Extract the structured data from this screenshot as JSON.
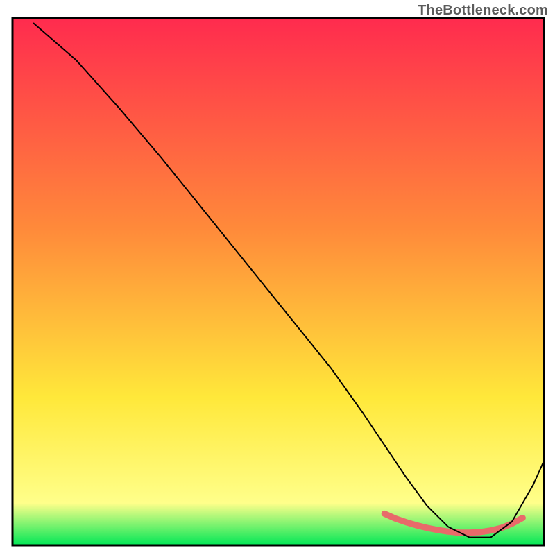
{
  "attribution": "TheBottleneck.com",
  "chart_data": {
    "type": "line",
    "title": "",
    "xlabel": "",
    "ylabel": "",
    "xlim": [
      0,
      100
    ],
    "ylim": [
      0,
      100
    ],
    "grid": false,
    "legend": false,
    "background_gradient": {
      "top": "#ff2b4e",
      "mid1": "#ff8a3a",
      "mid2": "#ffe83a",
      "low": "#ffff8a",
      "bottom": "#00e756"
    },
    "series": [
      {
        "name": "bottleneck-curve",
        "color": "#000000",
        "stroke_width": 2,
        "x": [
          4,
          12,
          20,
          28,
          36,
          44,
          52,
          60,
          66,
          70,
          74,
          78,
          82,
          86,
          90,
          94,
          98,
          100
        ],
        "y": [
          99,
          92,
          83,
          73.5,
          63.5,
          53.5,
          43.5,
          33.5,
          25,
          19,
          13,
          7.5,
          3.5,
          1.5,
          1.5,
          4.5,
          11.5,
          16
        ]
      },
      {
        "name": "optimal-range-marker",
        "color": "#e86a6a",
        "stroke_width": 9,
        "x": [
          70,
          72,
          74,
          76,
          78,
          80,
          82,
          84,
          86,
          88,
          90,
          92,
          94,
          96
        ],
        "y": [
          6.0,
          5.1,
          4.4,
          3.8,
          3.3,
          2.9,
          2.6,
          2.4,
          2.4,
          2.5,
          2.8,
          3.3,
          4.1,
          5.2
        ]
      }
    ],
    "annotations": []
  },
  "plot_geometry": {
    "outer_w": 800,
    "outer_h": 800,
    "inner_x": 18,
    "inner_y": 26,
    "inner_w": 766,
    "inner_h": 760,
    "frame_stroke": "#000000",
    "frame_width": 3
  }
}
